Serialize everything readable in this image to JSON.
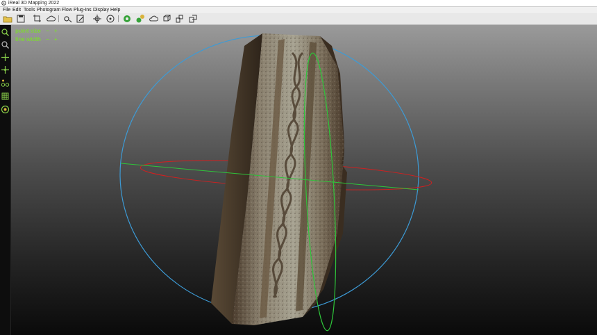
{
  "window": {
    "title": "iReal 3D Mapping 2022"
  },
  "menu": [
    "File",
    "Edit",
    "Tools",
    "Photogram",
    "Flow",
    "Plug-Ins",
    "Display",
    "Help"
  ],
  "toolbar": [
    {
      "icon": "open-folder-icon"
    },
    {
      "icon": "save-icon"
    },
    {
      "icon": "crop-icon"
    },
    {
      "icon": "cloud-icon"
    },
    {
      "icon": "settings-cog-icon"
    },
    {
      "icon": "edit-icon"
    },
    {
      "icon": "target-icon"
    },
    {
      "icon": "nodes-icon"
    },
    {
      "icon": "gears-icon"
    },
    {
      "icon": "gears-alt-icon"
    },
    {
      "icon": "cloud-upload-icon"
    },
    {
      "icon": "cube-icon"
    },
    {
      "icon": "cube-stack-icon"
    },
    {
      "icon": "cube-export-icon"
    },
    {
      "icon": "cube-copy-icon"
    }
  ],
  "left_tools": [
    {
      "icon": "zoom-icon"
    },
    {
      "icon": "zoom-extents-icon"
    },
    {
      "icon": "move-icon"
    },
    {
      "icon": "crosshair-icon"
    },
    {
      "icon": "measure-icon"
    },
    {
      "icon": "grid-icon"
    },
    {
      "icon": "target-dot-icon"
    }
  ],
  "overlay": {
    "point_size": {
      "label": "point size",
      "minus": "−",
      "plus": "+"
    },
    "line_width": {
      "label": "line width",
      "minus": "−",
      "plus": "+"
    }
  },
  "colors": {
    "overlay_text": "#7fd33a",
    "gizmo_ring_blue": "#3d9bd6",
    "gizmo_ring_green": "#2ec43a",
    "gizmo_ring_red": "#d02020"
  }
}
